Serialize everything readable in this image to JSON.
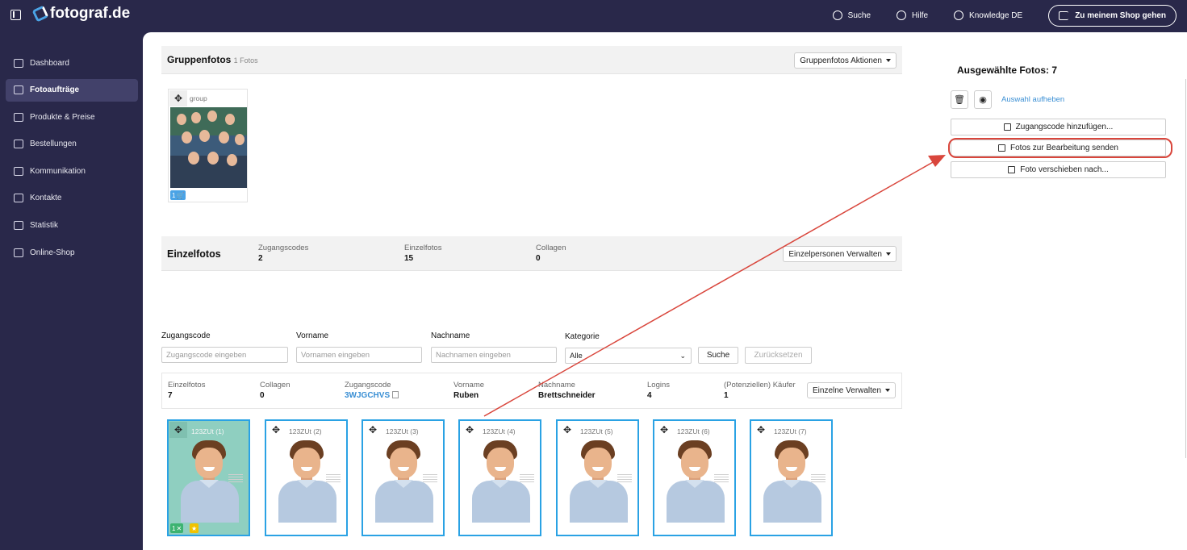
{
  "app": {
    "logo": "fotograf.de"
  },
  "topnav": {
    "search": "Suche",
    "help": "Hilfe",
    "knowledge": "Knowledge DE",
    "shop": "Zu meinem Shop gehen"
  },
  "sidebar": {
    "items": [
      {
        "label": "Dashboard"
      },
      {
        "label": "Fotoaufträge"
      },
      {
        "label": "Produkte & Preise"
      },
      {
        "label": "Bestellungen"
      },
      {
        "label": "Kommunikation"
      },
      {
        "label": "Kontakte"
      },
      {
        "label": "Statistik"
      },
      {
        "label": "Online-Shop"
      }
    ]
  },
  "group": {
    "title": "Gruppenfotos",
    "count": "1 Fotos",
    "actions": "Gruppenfotos Aktionen",
    "card_label": "group",
    "badge": "1"
  },
  "single": {
    "title": "Einzelfotos",
    "stats": [
      {
        "label": "Zugangscodes",
        "value": "2"
      },
      {
        "label": "Einzelfotos",
        "value": "15"
      },
      {
        "label": "Collagen",
        "value": "0"
      }
    ],
    "manage": "Einzelpersonen Verwalten"
  },
  "filter": {
    "code_label": "Zugangscode",
    "code_ph": "Zugangscode eingeben",
    "first_label": "Vorname",
    "first_ph": "Vornamen eingeben",
    "last_label": "Nachname",
    "last_ph": "Nachnamen eingeben",
    "cat_label": "Kategorie",
    "cat_value": "Alle",
    "search": "Suche",
    "reset": "Zurücksetzen"
  },
  "info": {
    "single_label": "Einzelfotos",
    "single_value": "7",
    "coll_label": "Collagen",
    "coll_value": "0",
    "code_label": "Zugangscode",
    "code_value": "3WJGCHVS",
    "first_label": "Vorname",
    "first_value": "Ruben",
    "last_label": "Nachname",
    "last_value": "Brettschneider",
    "logins_label": "Logins",
    "logins_value": "4",
    "buyers_label": "(Potenziellen) Käufer",
    "buyers_value": "1",
    "manage": "Einzelne Verwalten"
  },
  "photos": [
    {
      "label": "123ZUt (1)"
    },
    {
      "label": "123ZUt (2)"
    },
    {
      "label": "123ZUt (3)"
    },
    {
      "label": "123ZUt (4)"
    },
    {
      "label": "123ZUt (5)"
    },
    {
      "label": "123ZUt (6)"
    },
    {
      "label": "123ZUt (7)"
    }
  ],
  "first_badge": "1",
  "right": {
    "title": "Ausgewählte Fotos: 7",
    "clear": "Auswahl aufheben",
    "add_code": "Zugangscode hinzufügen...",
    "send_edit": "Fotos zur Bearbeitung senden",
    "move": "Foto verschieben nach..."
  },
  "colors": {
    "bg_dark": "#29284a",
    "accent": "#2aa2e4",
    "highlight": "#d9463c",
    "selected": "#8fcfc0"
  }
}
